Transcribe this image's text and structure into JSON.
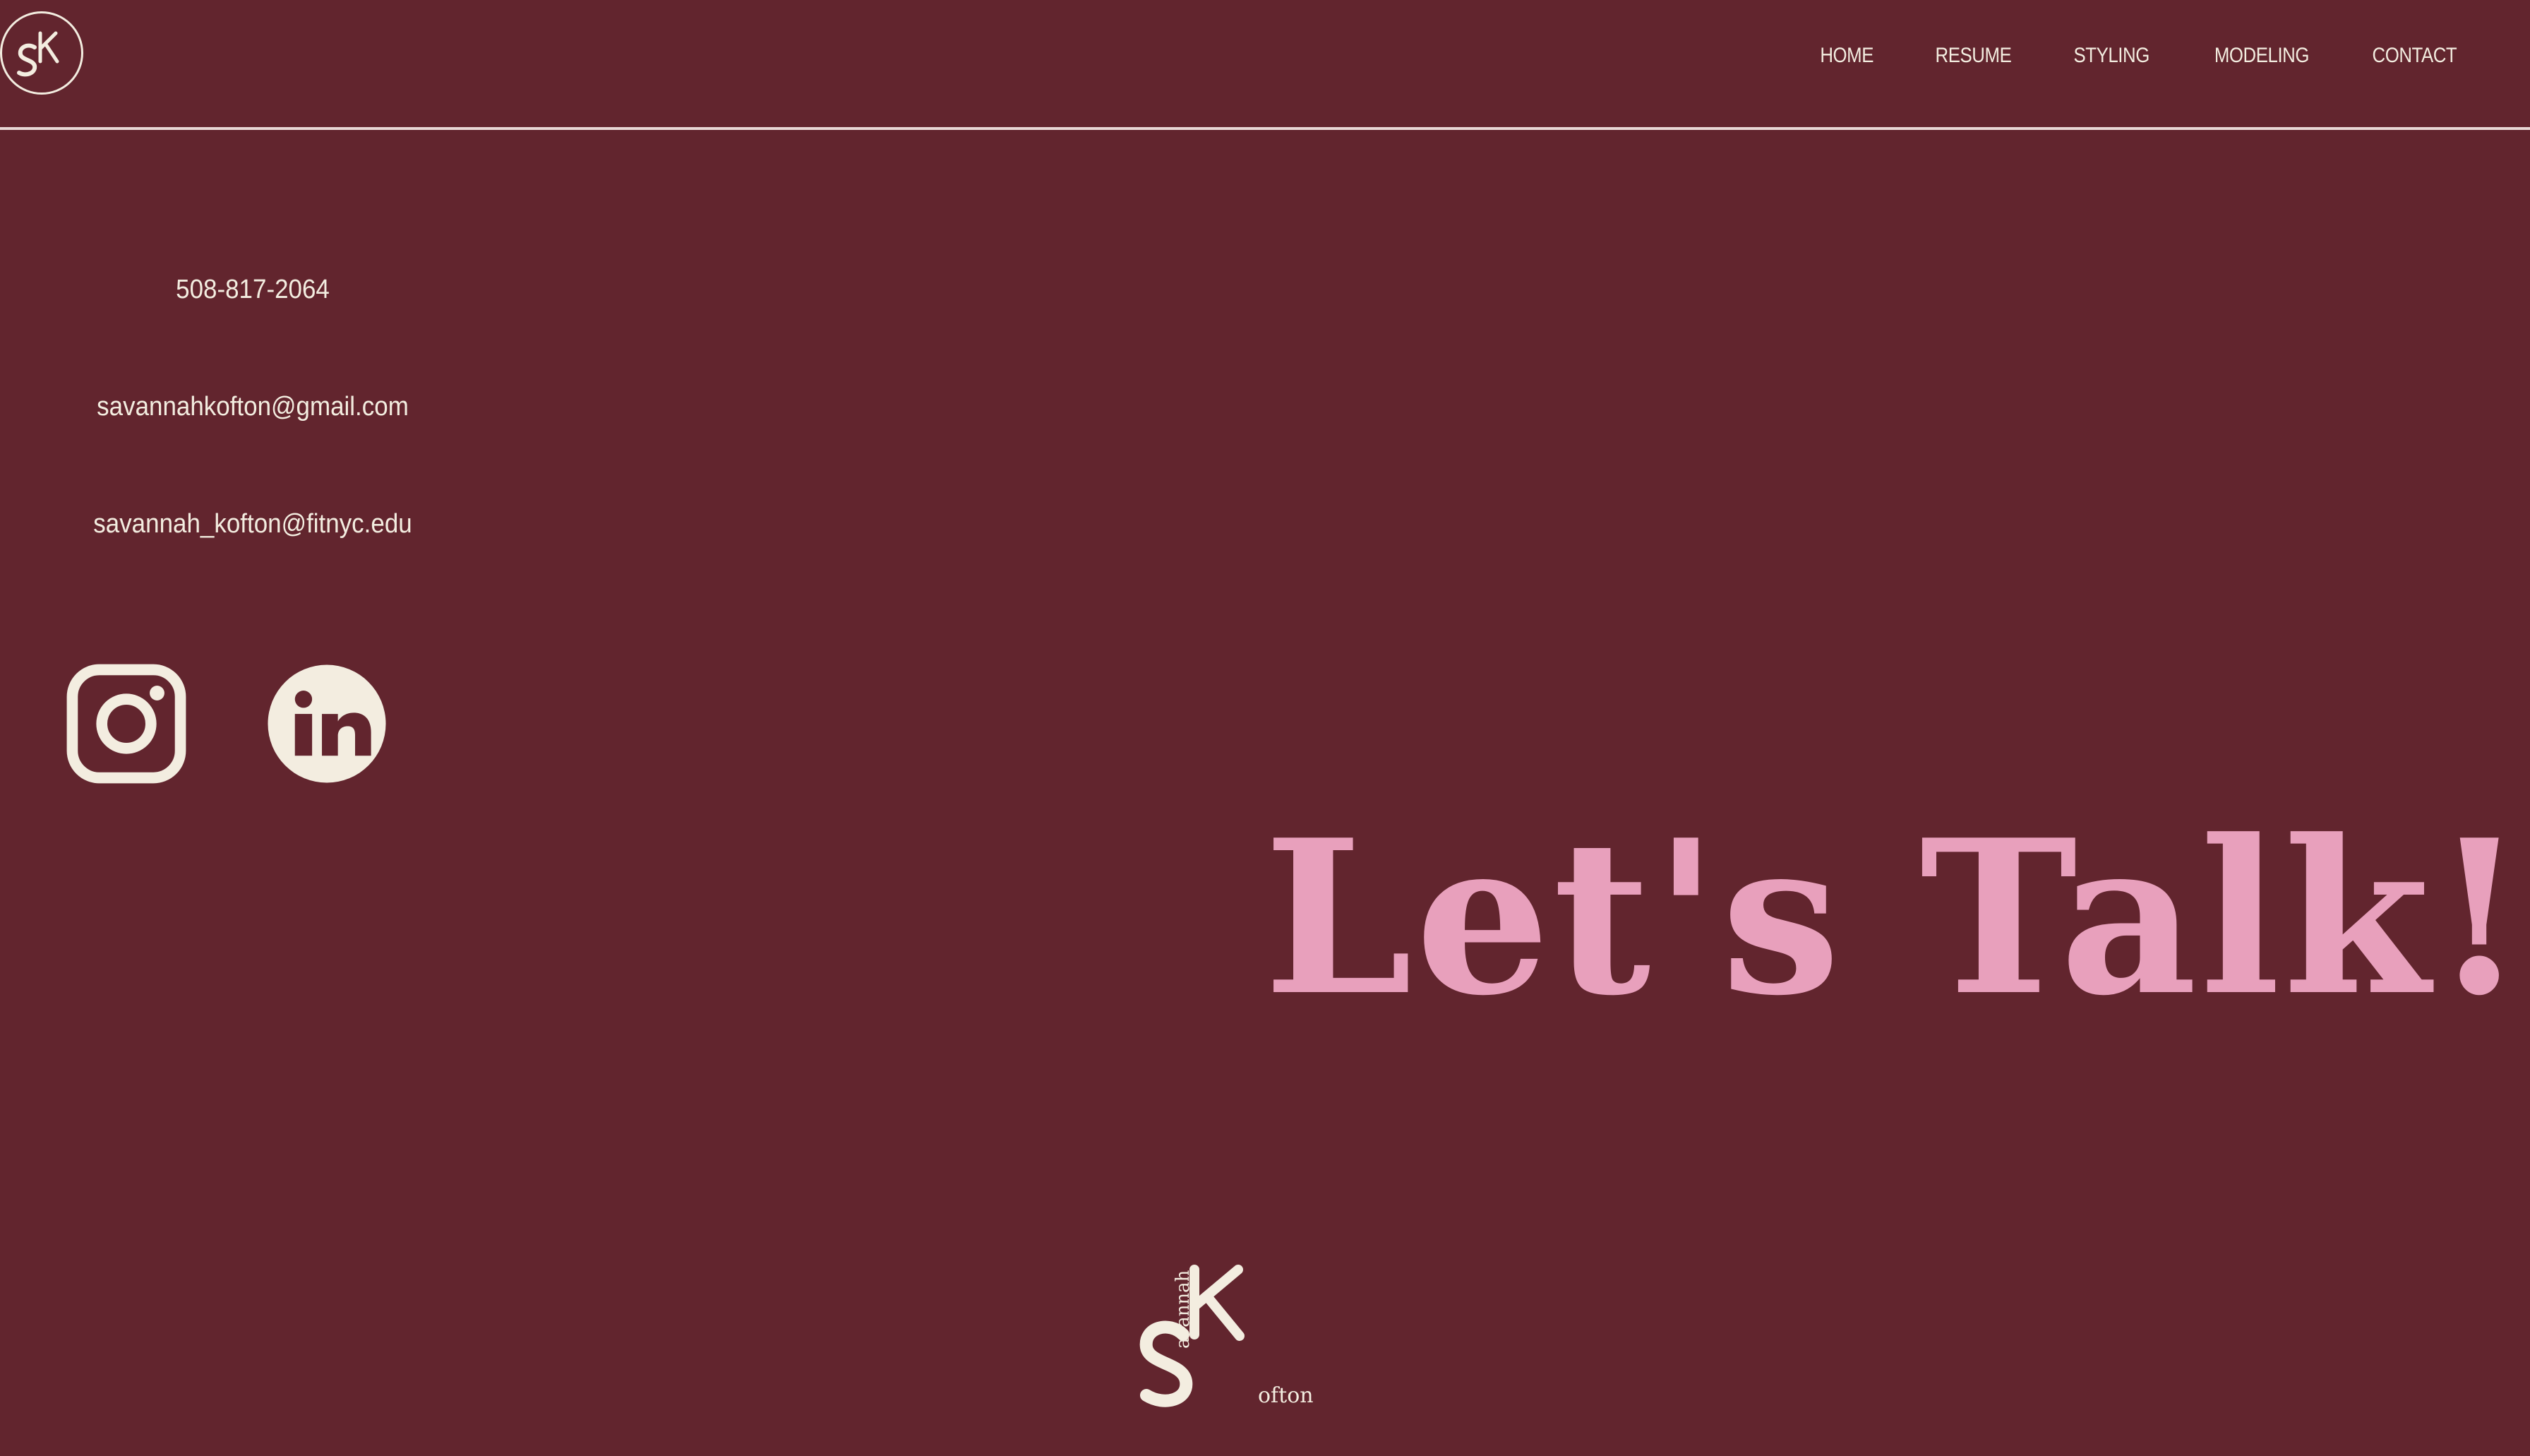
{
  "header": {
    "logo_icon": "sk-monogram-logo-icon",
    "nav": [
      {
        "label": "HOME"
      },
      {
        "label": "RESUME"
      },
      {
        "label": "STYLING"
      },
      {
        "label": "MODELING"
      },
      {
        "label": "CONTACT"
      }
    ]
  },
  "contact": {
    "phone": "508-817-2064",
    "email_personal": "savannahkofton@gmail.com",
    "email_school": "savannah_kofton@fitnyc.edu"
  },
  "social": [
    {
      "name": "instagram-icon"
    },
    {
      "name": "linkedin-icon",
      "text": "in"
    }
  ],
  "headline": "Let's Talk!",
  "footer_logo": {
    "first": "avannah",
    "last": "ofton"
  },
  "colors": {
    "background": "#62252e",
    "text": "#f3ede0",
    "accent": "#e8a0bc"
  }
}
